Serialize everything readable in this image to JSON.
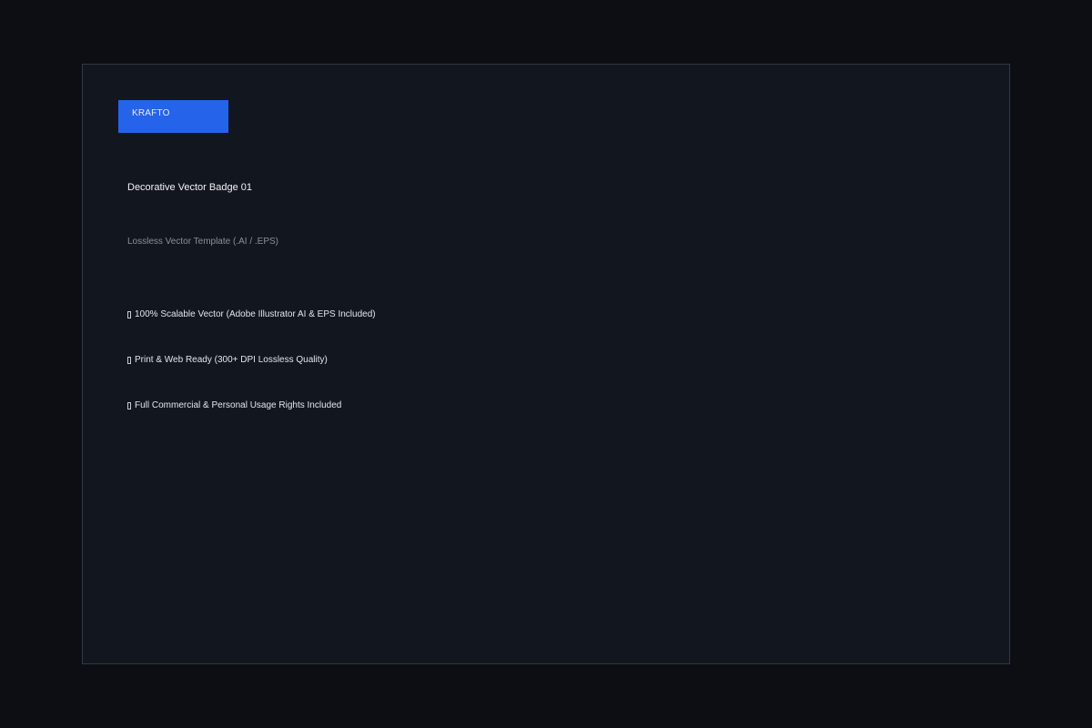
{
  "colors": {
    "page_background": "#0c0e13",
    "card_background": "#12161e",
    "card_border": "#323847",
    "brand_badge": "#2563eb",
    "title_text": "#f1f3f7",
    "subtitle_text": "#8a909c",
    "feature_text": "#e3e6ec"
  },
  "brand": {
    "label": "KRAFTO"
  },
  "product": {
    "title": "Decorative Vector Badge 01",
    "subtitle": "Lossless Vector Template (.AI / .EPS)"
  },
  "features": [
    {
      "icon": "missing-glyph-icon",
      "label": "100% Scalable Vector (Adobe Illustrator AI & EPS Included)"
    },
    {
      "icon": "missing-glyph-icon",
      "label": "Print & Web Ready (300+ DPI Lossless Quality)"
    },
    {
      "icon": "missing-glyph-icon",
      "label": "Full Commercial & Personal Usage Rights Included"
    }
  ]
}
